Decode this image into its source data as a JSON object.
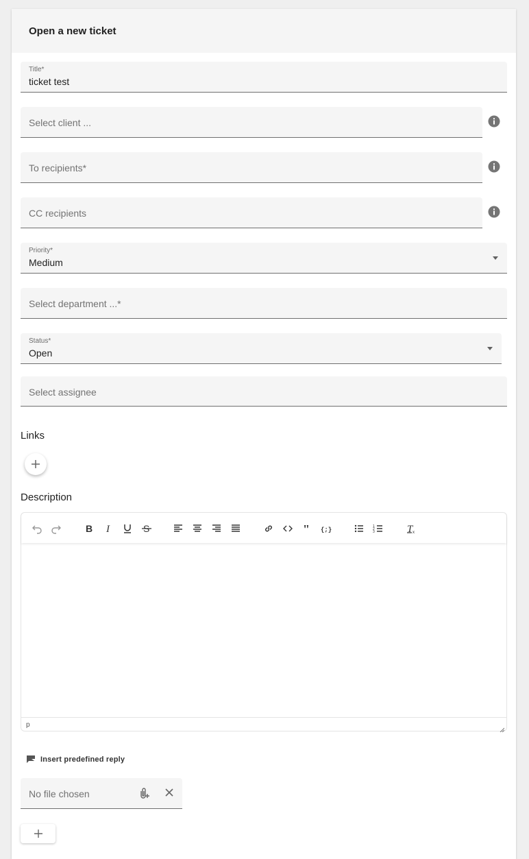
{
  "header": {
    "title": "Open a new ticket"
  },
  "fields": {
    "title": {
      "label": "Title*",
      "value": "ticket test"
    },
    "client": {
      "placeholder": "Select client ..."
    },
    "to_recipients": {
      "placeholder": "To recipients*"
    },
    "cc_recipients": {
      "placeholder": "CC recipients"
    },
    "priority": {
      "label": "Priority*",
      "value": "Medium"
    },
    "department": {
      "placeholder": "Select department ...*"
    },
    "status": {
      "label": "Status*",
      "value": "Open"
    },
    "assignee": {
      "placeholder": "Select assignee"
    }
  },
  "links": {
    "label": "Links"
  },
  "description": {
    "label": "Description",
    "status_path": "p",
    "toolbar": [
      "undo-icon",
      "redo-icon",
      "bold-icon",
      "italic-icon",
      "underline-icon",
      "strikethrough-icon",
      "align-left-icon",
      "align-center-icon",
      "align-right-icon",
      "align-justify-icon",
      "link-icon",
      "code-icon",
      "blockquote-icon",
      "code-block-icon",
      "bullet-list-icon",
      "numbered-list-icon",
      "clear-format-icon"
    ]
  },
  "predefined_reply": {
    "label": "Insert predefined reply"
  },
  "attachment": {
    "placeholder": "No file chosen"
  },
  "colors": {
    "field_bg": "#f5f5f5",
    "info_icon": "#757575",
    "text": "#212121"
  }
}
